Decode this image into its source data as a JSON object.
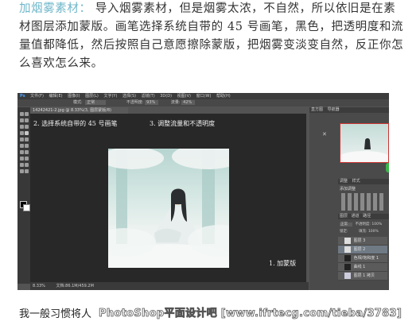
{
  "paragraph": {
    "highlight": "加烟雾素材：",
    "text": "导入烟雾素材，但是烟雾太浓，不自然，所以依旧是在素材图层添加蒙版。画笔选择系统自带的 45 号画笔，黑色，把透明度和流量值都降低，然后按照自己意愿擦除蒙版，把烟雾变淡变自然，反正你怎么喜欢怎么来。"
  },
  "photoshop": {
    "logo": "Ps",
    "menu": [
      "文件(F)",
      "编辑(E)",
      "图像(I)",
      "图层(L)",
      "文字(Y)",
      "选择(S)",
      "滤镜(T)",
      "3D(D)",
      "视图(V)",
      "窗口(W)",
      "帮助(H)"
    ],
    "options": {
      "mode_label": "模式:",
      "mode_value": "正常",
      "opacity_label": "不透明度:",
      "opacity_value": "93%",
      "flow_label": "流量:",
      "flow_value": "42%"
    },
    "doc_tab": "14242421-2.jpg @ 8.33%(3, 图层蒙版/8)",
    "instructions": {
      "step2": "2. 选择系统自带的 45 号画笔",
      "step3": "3. 调整流量和不透明度",
      "step1": "1. 加蒙版"
    },
    "status": {
      "zoom": "8.33%",
      "doc": "文档:86.1M/459.2M"
    },
    "panels": {
      "navigator_tabs": [
        "直方图",
        "导航器"
      ],
      "adjust_tabs": [
        "调整",
        "样式"
      ],
      "adjust_title": "添加调整",
      "layer_tabs": [
        "图层",
        "通道",
        "路径"
      ],
      "blend_mode": "正常",
      "opacity_label": "不透明度:",
      "opacity_value": "100%",
      "lock_label": "锁定:",
      "fill_label": "填充:",
      "fill_value": "100%",
      "layers": [
        "图层 3",
        "图层 2",
        "色相/饱和度 1",
        "曲线 1",
        "图层 1 拷贝"
      ]
    }
  },
  "footer": {
    "text": "我一般习惯将人"
  },
  "watermark": {
    "text": "PhotoShop平面设计吧 [www.ifrtecg.com/tieba/3783]"
  }
}
